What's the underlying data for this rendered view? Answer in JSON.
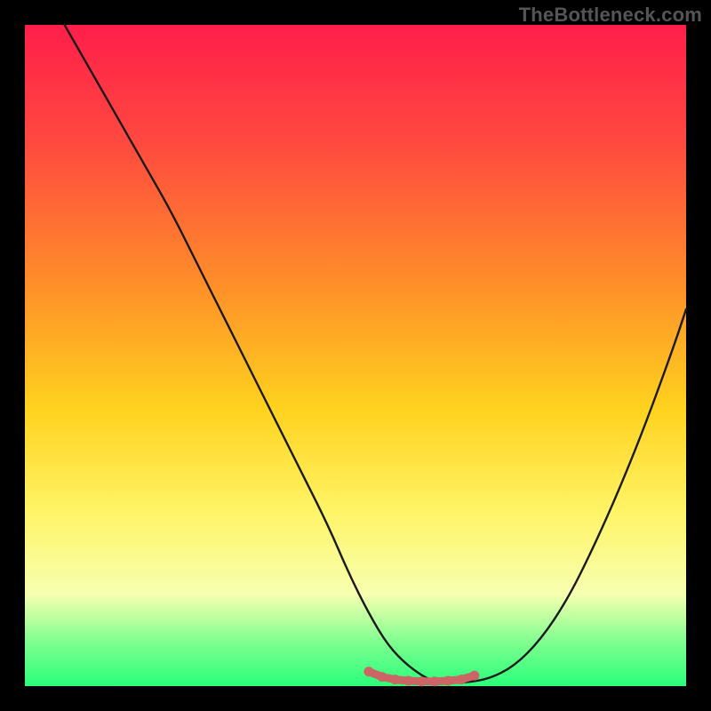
{
  "watermark": "TheBottleneck.com",
  "colors": {
    "background": "#000000",
    "gradient_top": "#ff1e4a",
    "gradient_bottom": "#2bff7a",
    "curve": "#1a1a1a",
    "marker": "#cc6666"
  },
  "chart_data": {
    "type": "line",
    "title": "",
    "xlabel": "",
    "ylabel": "",
    "xlim": [
      0,
      100
    ],
    "ylim": [
      0,
      100
    ],
    "series": [
      {
        "name": "curve",
        "x": [
          6,
          10,
          14,
          18,
          22,
          26,
          30,
          34,
          38,
          42,
          46,
          49,
          52,
          55,
          58,
          61,
          63,
          66,
          70,
          74,
          78,
          82,
          86,
          90,
          94,
          98,
          100
        ],
        "y": [
          100,
          93,
          86,
          79,
          72,
          64,
          56,
          48,
          40,
          32,
          24,
          17,
          11,
          6,
          3,
          1,
          0.5,
          0.5,
          1,
          3,
          7,
          13,
          21,
          30,
          40,
          51,
          57
        ]
      }
    ],
    "markers": {
      "name": "trough-highlight",
      "x": [
        52,
        54,
        56,
        58,
        60,
        62,
        64,
        66,
        68
      ],
      "y": [
        2.2,
        1.4,
        1.0,
        0.8,
        0.7,
        0.7,
        0.8,
        1.0,
        1.6
      ]
    }
  }
}
